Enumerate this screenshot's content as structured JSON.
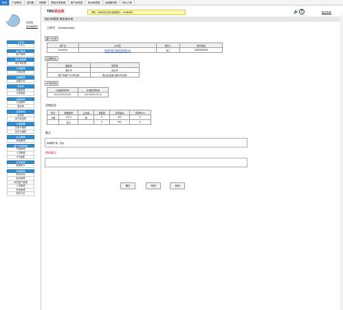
{
  "topnav": [
    "首页",
    "产品概况",
    "结构图",
    "流程图",
    "需量米表数据",
    "客户结构型",
    "承运商类型",
    "运输路线型",
    "待办订单"
  ],
  "left": {
    "user": "测试用",
    "role": "测试管理员",
    "menu": [
      {
        "head": "工作台",
        "items": [
          "个人中心"
        ]
      },
      {
        "head": "客户管理",
        "items": [
          "客户管理"
        ]
      },
      {
        "head": "询价单管理",
        "items": [
          "询价单处理"
        ]
      },
      {
        "head": "订单管理",
        "items": [
          "订单处理"
        ]
      },
      {
        "head": "运输管理",
        "items": [
          "运输计划"
        ]
      },
      {
        "head": "承运商",
        "items": [
          "调度配载",
          "订单追踪"
        ]
      },
      {
        "head": "运输结算",
        "items": [
          "在途跟踪",
          "签收单"
        ]
      },
      {
        "head": "结算管理",
        "items": [
          "应收款",
          "应付款结算"
        ]
      },
      {
        "head": "价格管理",
        "items": [
          "应收价格表",
          "应付价格表"
        ]
      },
      {
        "head": "运力管理",
        "items": [
          "承运管理"
        ]
      },
      {
        "head": "客户资源管理",
        "items": [
          "车辆管理",
          "人员管理",
          "KPI管理"
        ]
      },
      {
        "head": "信息管理",
        "items": [
          "客服统计"
        ]
      },
      {
        "head": "系统管理",
        "items": [
          "基础信息",
          "网点管理",
          "司机账户管理",
          "人员管理",
          "系统管理",
          "操作日志"
        ]
      }
    ]
  },
  "header": {
    "logo_a": "TMS",
    "logo_b": "承运商",
    "notice": "通知：系统将定时进行数据备份，TMS承运商",
    "badge": "8",
    "logout": "退出系统"
  },
  "page_title": "询价单管理-审核询价单",
  "order_label": "订单号：15066666666",
  "customer": {
    "label": "客户信息",
    "headers": [
      "用户名",
      "公司名",
      "联系人",
      "联系电话"
    ],
    "row": [
      "zenvehan",
      "深圳市泰产品科技有限公司",
      "张三",
      "15666666666"
    ]
  },
  "shipping": {
    "label": "运输地址",
    "headers": [
      "起始地",
      "目的地"
    ],
    "rows": [
      [
        "城中市",
        "武汉市"
      ],
      [
        "南宁市南宁123号仓库",
        "横山区高速公路16号仓库"
      ]
    ]
  },
  "schedule": {
    "label": "计划时间",
    "headers": [
      "计划装货时间",
      "计划卸货时间"
    ],
    "row": [
      "2017/09/24  09:10",
      "2017/09/24  09:15"
    ]
  },
  "goods": {
    "label": "货物信息",
    "headers": [
      "货名",
      "规格型号",
      "主包装",
      "总数量",
      "总重量kg",
      "总体积 m³"
    ],
    "rows": [
      [
        "沙糖",
        "1x0.4",
        "袋",
        "5",
        "500",
        "5"
      ],
      [
        "",
        "合计",
        "",
        "5",
        "500",
        "5"
      ]
    ]
  },
  "remark": {
    "label": "备注",
    "text": "车辆要干净、防水"
  },
  "review": {
    "label": "审核意见",
    "text": ""
  },
  "buttons": [
    "通过",
    "驳回",
    "返回"
  ]
}
